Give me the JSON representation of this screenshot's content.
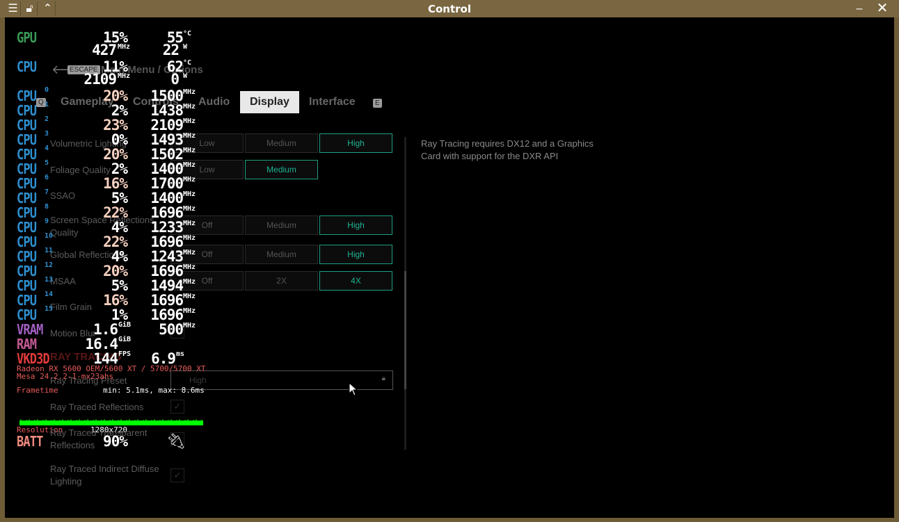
{
  "window": {
    "title": "Control"
  },
  "menu": {
    "escape_key": "ESCAPE",
    "breadcrumb": "Main Menu / Options",
    "tab_prev_key": "Q",
    "tab_next_key": "E",
    "tabs": [
      {
        "label": "Gameplay"
      },
      {
        "label": "Controls"
      },
      {
        "label": "Audio"
      },
      {
        "label": "Display",
        "selected": true
      },
      {
        "label": "Interface"
      }
    ],
    "settings": [
      {
        "label": "Volumetric Lighting",
        "options": [
          "Low",
          "Medium",
          "High"
        ],
        "selected": "High"
      },
      {
        "label": "Foliage Quality",
        "options": [
          "Low",
          "Medium"
        ],
        "selected": "Medium"
      },
      {
        "label": "SSAO"
      },
      {
        "label": "Screen Space Reflections Quality",
        "options": [
          "Off",
          "Medium",
          "High"
        ],
        "selected": "High"
      },
      {
        "label": "Global Reflections",
        "options": [
          "Off",
          "Medium",
          "High"
        ],
        "selected": "High"
      },
      {
        "label": "MSAA",
        "options": [
          "Off",
          "2X",
          "4X"
        ],
        "selected": "4X"
      },
      {
        "label": "Film Grain"
      },
      {
        "label": "Motion Blur",
        "checkbox": true
      }
    ],
    "section_header": "RAY TRACING",
    "rt_preset": {
      "label": "Ray Tracing Preset",
      "value": "High"
    },
    "rt_options": [
      {
        "label": "Ray Traced Reflections"
      },
      {
        "label": "Ray Traced Transparent Reflections"
      },
      {
        "label": "Ray Traced Indirect Diffuse Lighting"
      }
    ],
    "description": "Ray Tracing requires DX12 and a Graphics Card with support for the DXR API"
  },
  "hud": {
    "gpu": {
      "label": "GPU",
      "load": "15",
      "temp": "55",
      "clock": "427",
      "power": "22"
    },
    "cpu": {
      "label": "CPU",
      "load": "11",
      "temp": "62",
      "clock": "2109",
      "power": "0"
    },
    "cores": [
      [
        "20",
        "1500"
      ],
      [
        "2",
        "1438"
      ],
      [
        "23",
        "2109"
      ],
      [
        "0",
        "1493"
      ],
      [
        "20",
        "1502"
      ],
      [
        "2",
        "1400"
      ],
      [
        "16",
        "1700"
      ],
      [
        "5",
        "1400"
      ],
      [
        "22",
        "1696"
      ],
      [
        "4",
        "1233"
      ],
      [
        "22",
        "1696"
      ],
      [
        "4",
        "1243"
      ],
      [
        "20",
        "1696"
      ],
      [
        "5",
        "1494"
      ],
      [
        "16",
        "1696"
      ],
      [
        "1",
        "1696"
      ]
    ],
    "vram": {
      "label": "VRAM",
      "used": "1.6",
      "clock": "500"
    },
    "ram": {
      "label": "RAM",
      "used": "16.4"
    },
    "vkd3d": {
      "label": "VKD3D",
      "fps": "144",
      "frametime": "6.9"
    },
    "gpu_name": "Radeon RX 5600 OEM/5600 XT / 5700/5700 XT",
    "driver": "Mesa 24.2.2-1-mx23ahs",
    "frametime_label": "Frametime",
    "frametime_range": "min: 5.1ms, max: 8.6ms",
    "resolution_label": "Resolution",
    "resolution": "1280x720",
    "batt": {
      "label": "BATT",
      "percent": "90"
    },
    "units": {
      "pct": "%",
      "deg": "°C",
      "mhz": "MHz",
      "w": "W",
      "gib": "GiB",
      "fps": "FPS",
      "ms": "ms"
    },
    "colors": {
      "gpu": "#3a9a56",
      "cpu": "#2e8fcf",
      "vram": "#a05fc0",
      "ram": "#c45a95",
      "vkd3d": "#e23b3b",
      "batt": "#f08a80",
      "high_load": "#f5d0bf",
      "graph": "#00ff00"
    }
  }
}
